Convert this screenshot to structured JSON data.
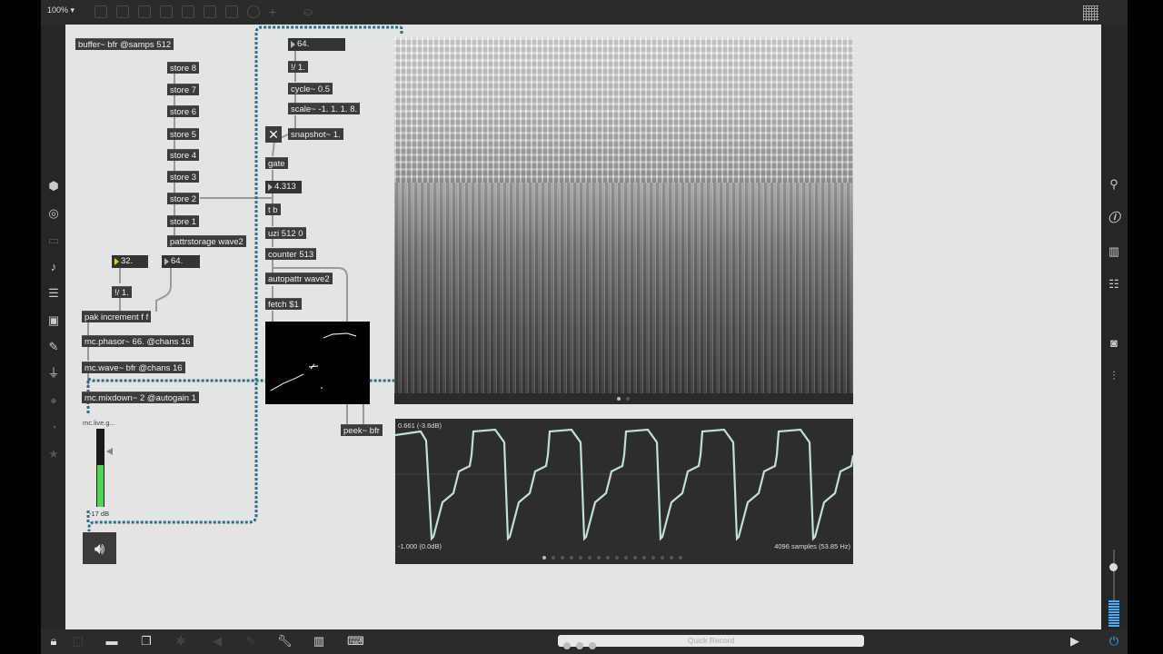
{
  "toolbar": {
    "zoom": "100%"
  },
  "patch": {
    "buffer": "buffer~ bfr @samps 512",
    "stores": [
      "store 8",
      "store 7",
      "store 6",
      "store 5",
      "store 4",
      "store 3",
      "store 2",
      "store 1"
    ],
    "pattrstorage": "pattrstorage wave2",
    "num_32": "32.",
    "num_64a": "64.",
    "div1a": "!/ 1.",
    "pak": "pak increment f f",
    "phasor": "mc.phasor~ 66. @chans 16",
    "wave": "mc.wave~ bfr @chans 16",
    "mixdown": "mc.mixdown~ 2 @autogain 1",
    "meter_label": "mc.live.g...",
    "meter_db": "-17 dB",
    "num_64b": "64.",
    "div1b": "!/ 1.",
    "cycle": "cycle~ 0.5",
    "scale": "scale~ -1. 1. 1. 8.",
    "snapshot": "snapshot~ 1.",
    "gate": "gate",
    "num_4313": "4.313",
    "tb": "t b",
    "uzi": "uzi 512 0",
    "counter": "counter 513",
    "autopattr": "autopattr wave2",
    "fetch": "fetch $1",
    "peek": "peek~ bfr"
  },
  "scope": {
    "max_label": "0.661 (-3.6dB)",
    "min_label": "-1.000 (0.0dB)",
    "samples_label": "4096 samples (53.85 Hz)"
  },
  "bottom": {
    "quick_record": "Quick Record"
  },
  "icons": {
    "left": [
      "cube-icon",
      "target-icon",
      "folder-icon",
      "music-note-icon",
      "list-play-icon",
      "image-icon",
      "clip-icon",
      "plug-icon",
      "dial-icon",
      "clock-icon",
      "star-icon"
    ],
    "right": [
      "search-icon",
      "info-icon",
      "book-icon",
      "list-icon",
      "camera-icon",
      "sliders-icon"
    ]
  },
  "colors": {
    "canvas": "#e4e4e4",
    "object": "#3c3c3c",
    "cord_signal": "#2a6f8a",
    "meter_green": "#4bd94b"
  }
}
